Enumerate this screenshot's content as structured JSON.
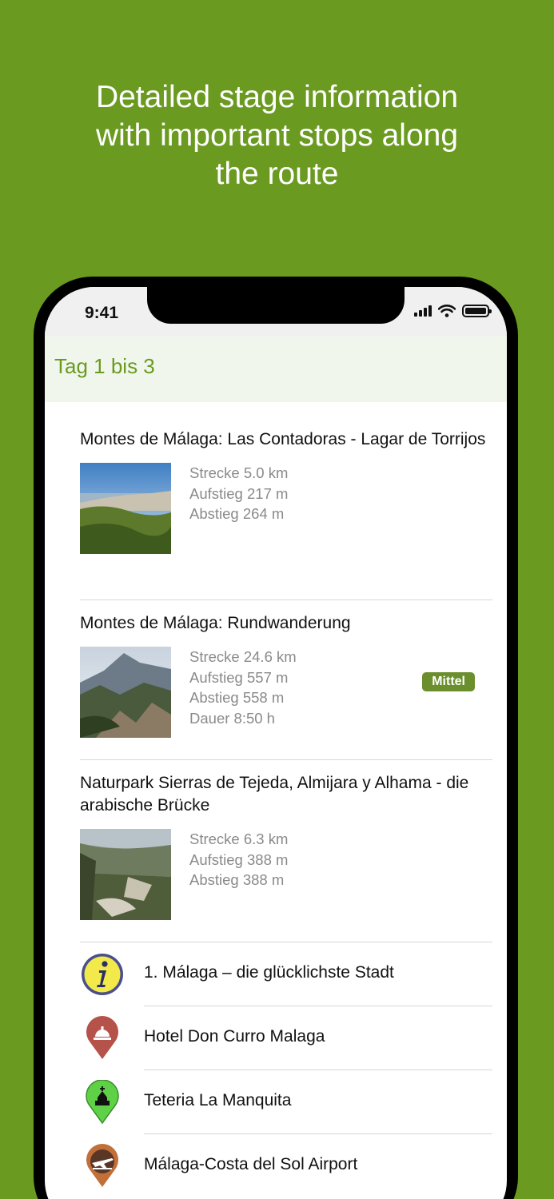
{
  "headline": {
    "line1": "Detailed stage information",
    "line2": "with important stops along",
    "line3": "the route"
  },
  "status_bar": {
    "time": "9:41"
  },
  "header": {
    "title": "Tag 1 bis 3"
  },
  "stages": [
    {
      "title": "Montes de Málaga: Las Contadoras - Lagar de Torrijos",
      "stats": [
        "Strecke 5.0 km",
        "Aufstieg 217 m",
        "Abstieg 264 m"
      ],
      "badge": ""
    },
    {
      "title": "Montes de Málaga: Rundwanderung",
      "stats": [
        "Strecke 24.6 km",
        "Aufstieg 557 m",
        "Abstieg 558 m",
        "Dauer 8:50 h"
      ],
      "badge": "Mittel"
    },
    {
      "title": "Naturpark Sierras de Tejeda, Almijara y Alhama - die arabische Brücke",
      "stats": [
        "Strecke 6.3 km",
        "Aufstieg 388 m",
        "Abstieg 388 m"
      ],
      "badge": ""
    }
  ],
  "pois": [
    {
      "label": "1. Málaga – die glücklichste Stadt",
      "icon": "info-icon",
      "color": "#4a4f8a"
    },
    {
      "label": "Hotel Don Curro Malaga",
      "icon": "hotel-bell-marker-icon",
      "color": "#b5524a"
    },
    {
      "label": "Teteria La Manquita",
      "icon": "church-marker-icon",
      "color": "#5fd146"
    },
    {
      "label": "Málaga-Costa del Sol Airport",
      "icon": "airport-marker-icon",
      "color": "#c2703a"
    }
  ],
  "colors": {
    "background": "#6a9a20",
    "accent": "#6a9a20",
    "badge": "#6a8f2c"
  }
}
